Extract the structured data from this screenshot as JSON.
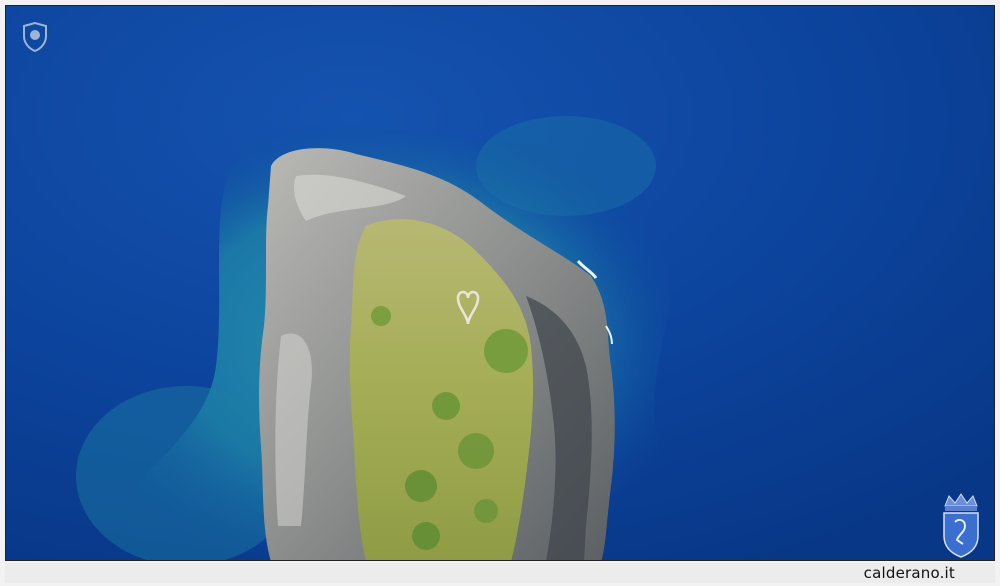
{
  "footer": {
    "site_label": "calderano.it"
  },
  "icons": {
    "top_left": "shield-watermark-icon",
    "bottom_right": "crowned-crest-icon"
  },
  "colors": {
    "deep_sea": "#0a3f98",
    "shallow_sea": "#1d8aa5",
    "rock": "#9fa0a0",
    "grass": "#a9b05a",
    "crest_blue": "#3a6fd0"
  }
}
